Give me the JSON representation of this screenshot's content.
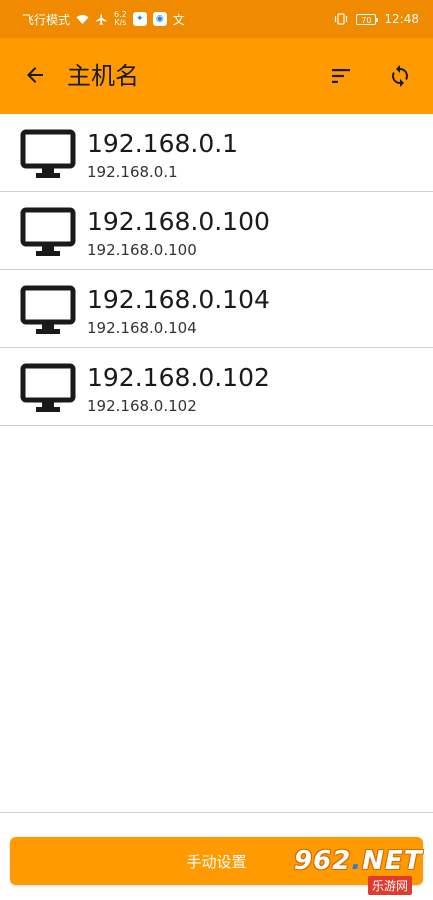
{
  "status_bar": {
    "mode_text": "飞行模式",
    "net_speed_value": "6.2",
    "net_speed_unit": "K/s",
    "battery_level": "70",
    "time": "12:48",
    "text_icon_glyph": "文"
  },
  "app_bar": {
    "title": "主机名",
    "back_icon": "arrow-left-icon",
    "sort_icon": "sort-icon",
    "refresh_icon": "refresh-icon"
  },
  "hosts": [
    {
      "name": "192.168.0.1",
      "ip": "192.168.0.1"
    },
    {
      "name": "192.168.0.100",
      "ip": "192.168.0.100"
    },
    {
      "name": "192.168.0.104",
      "ip": "192.168.0.104"
    },
    {
      "name": "192.168.0.102",
      "ip": "192.168.0.102"
    }
  ],
  "footer": {
    "manual_button_label": "手动设置"
  },
  "watermark": {
    "number_part": "962",
    "dot": ".",
    "suffix": "NET",
    "site": "乐游网"
  },
  "colors": {
    "status_bar": "#f08a00",
    "app_bar": "#ff9a00",
    "button": "#ff9a00",
    "divider": "#cfcfcf"
  }
}
